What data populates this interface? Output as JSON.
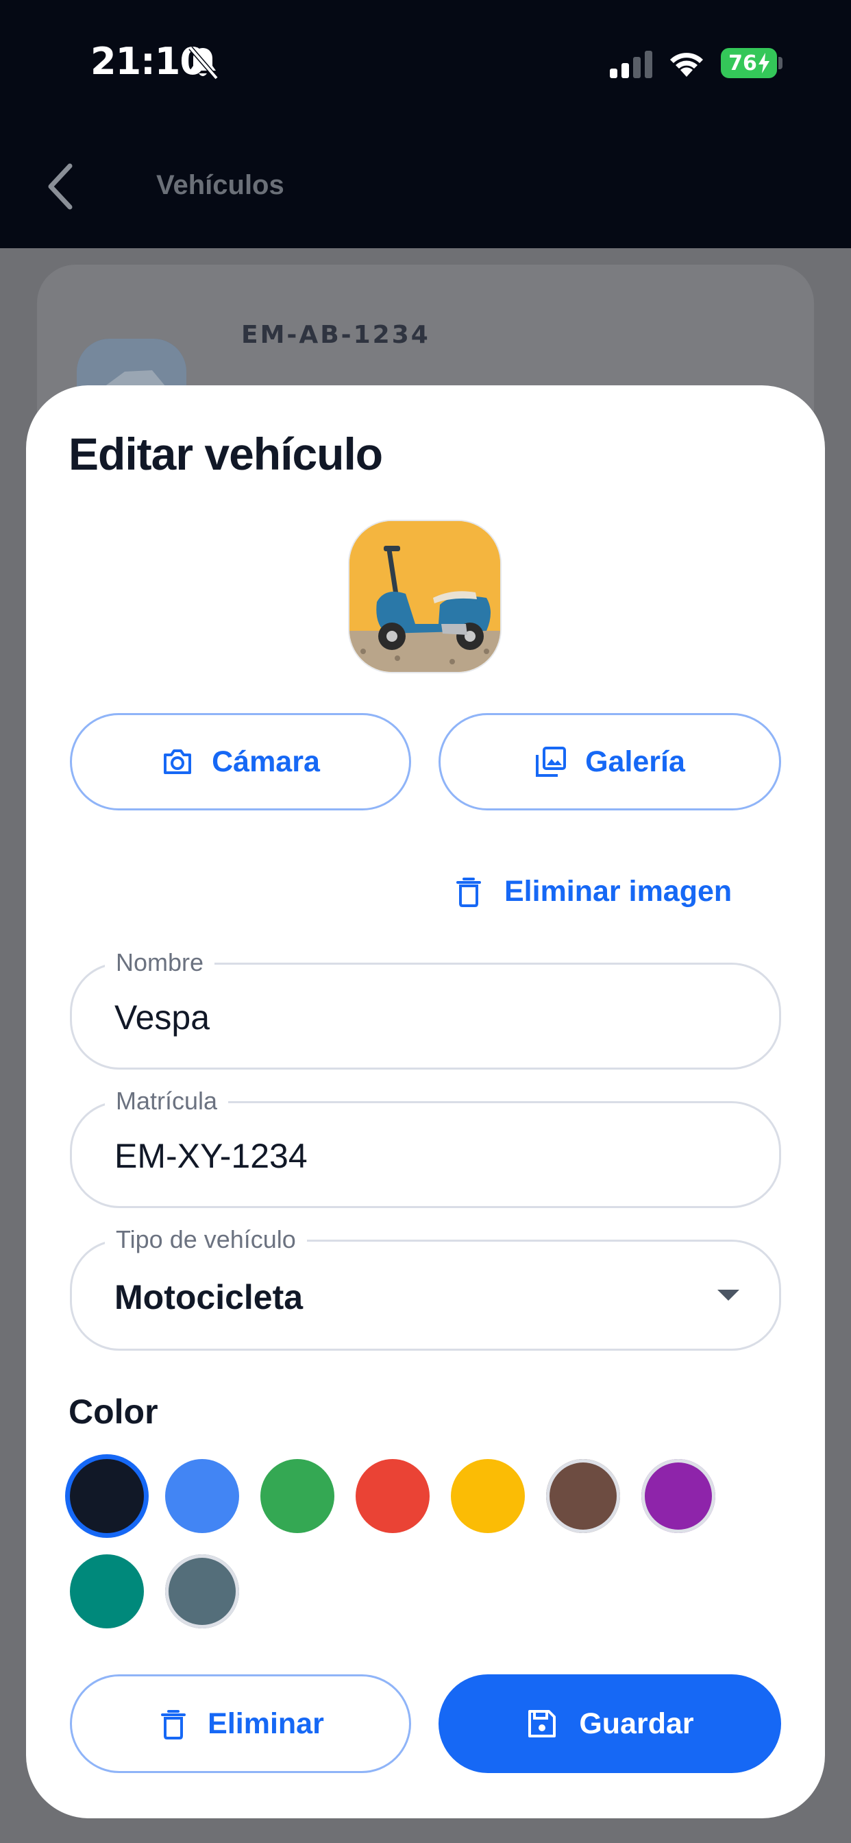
{
  "status_bar": {
    "time": "21:10",
    "battery": "76"
  },
  "nav": {
    "title": "Vehículos"
  },
  "background_list": {
    "first_plate": "EM-AB-1234"
  },
  "sheet": {
    "title": "Editar vehículo",
    "photo_buttons": {
      "camera": "Cámara",
      "gallery": "Galería"
    },
    "remove_image": "Eliminar imagen",
    "fields": {
      "name": {
        "label": "Nombre",
        "value": "Vespa"
      },
      "plate": {
        "label": "Matrícula",
        "value": "EM-XY-1234"
      },
      "type": {
        "label": "Tipo de vehículo",
        "value": "Motocicleta"
      }
    },
    "color_title": "Color",
    "colors": [
      "#111827",
      "#4285f4",
      "#34a853",
      "#ea4335",
      "#fbbc05",
      "#6d4c41",
      "#8e24aa",
      "#00897b",
      "#546e7a"
    ],
    "selected_color": "#111827",
    "actions": {
      "delete": "Eliminar",
      "save": "Guardar"
    }
  },
  "theme": {
    "accent": "#1668f5",
    "outline": "#8fb4f8"
  }
}
